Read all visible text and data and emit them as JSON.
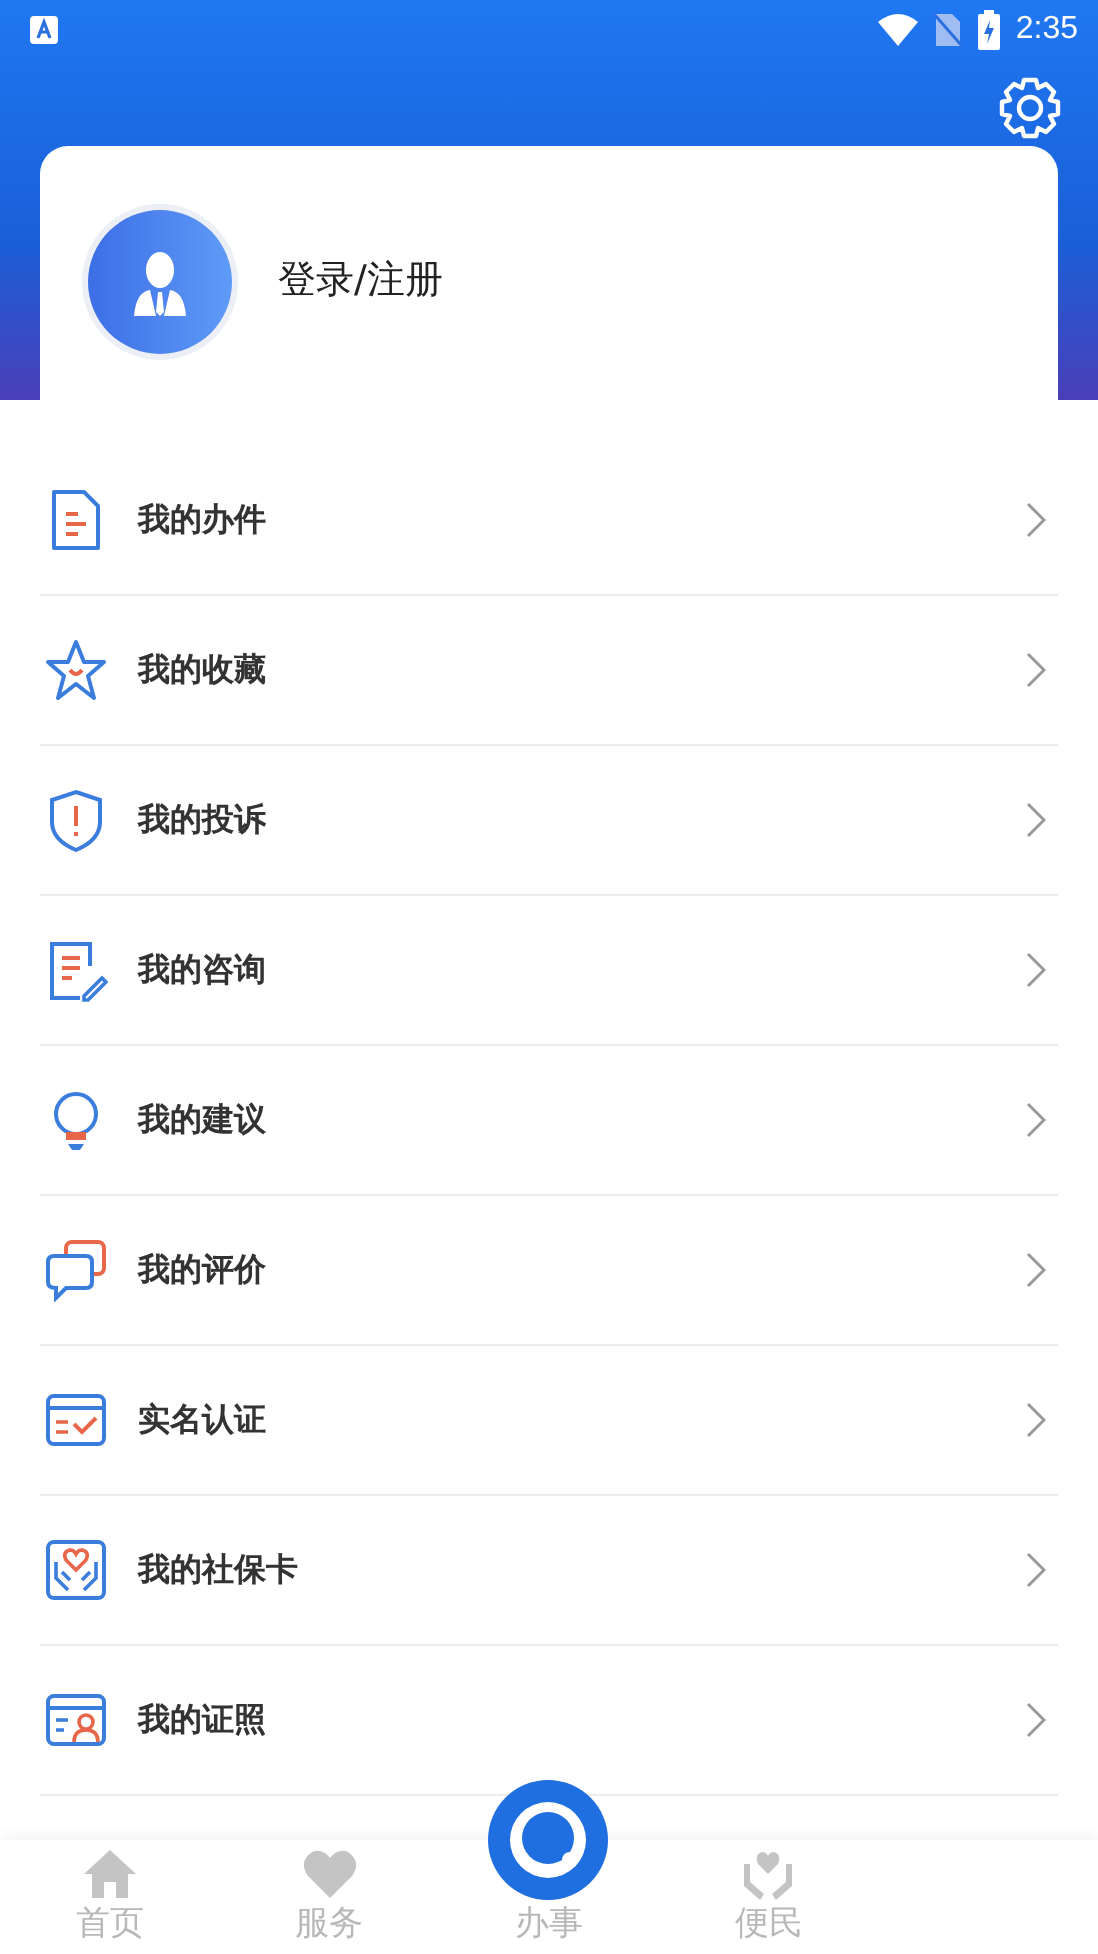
{
  "status_bar": {
    "time": "2:35"
  },
  "profile": {
    "login_label": "登录/注册"
  },
  "menu": [
    {
      "label": "我的办件"
    },
    {
      "label": "我的收藏"
    },
    {
      "label": "我的投诉"
    },
    {
      "label": "我的咨询"
    },
    {
      "label": "我的建议"
    },
    {
      "label": "我的评价"
    },
    {
      "label": "实名认证"
    },
    {
      "label": "我的社保卡"
    },
    {
      "label": "我的证照"
    }
  ],
  "tab_bar": [
    {
      "label": "首页",
      "selected": false
    },
    {
      "label": "服务",
      "selected": false
    },
    {
      "label": "办事",
      "selected": false,
      "kind": "center"
    },
    {
      "label": "便民",
      "selected": false
    }
  ]
}
